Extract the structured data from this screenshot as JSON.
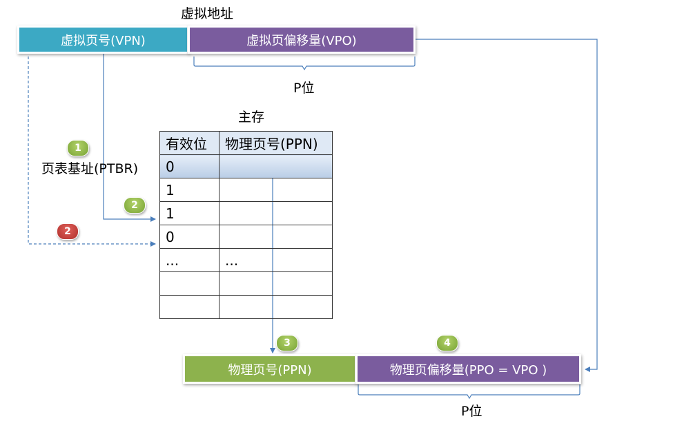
{
  "virtual_address": {
    "title": "虚拟地址",
    "vpn": "虚拟页号(VPN)",
    "vpo": "虚拟页偏移量(VPO)",
    "brace_label": "P位"
  },
  "main_memory": {
    "title": "主存",
    "headers": [
      "有效位",
      "物理页号(PPN)"
    ],
    "rows": [
      [
        "0",
        ""
      ],
      [
        "1",
        ""
      ],
      [
        "1",
        ""
      ],
      [
        "0",
        ""
      ],
      [
        "...",
        "..."
      ],
      [
        "",
        ""
      ],
      [
        "",
        ""
      ]
    ]
  },
  "ptbr_label": "页表基址(PTBR)",
  "physical_address": {
    "ppn": "物理页号(PPN)",
    "ppo": "物理页偏移量(PPO = VPO )",
    "brace_label": "P位"
  },
  "badges": [
    "1",
    "2",
    "2",
    "3",
    "4"
  ],
  "colors": {
    "vpn": "#3ca9c4",
    "vpo": "#7a5c9e",
    "ppn": "#8db24d",
    "badge_green": "#8db24d",
    "badge_red": "#c0392b",
    "arrow": "#4a7ebb"
  }
}
